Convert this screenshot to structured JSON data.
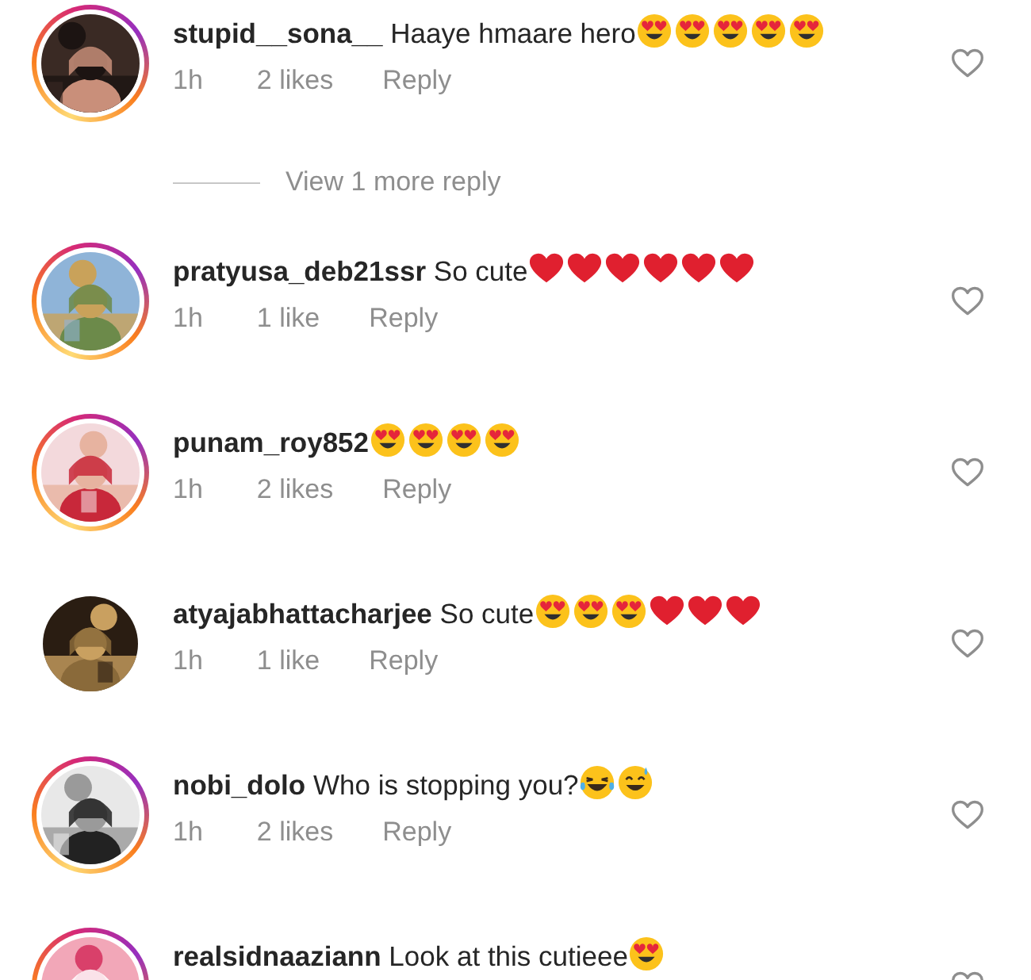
{
  "comments": [
    {
      "username": "stupid__sona__",
      "text": "Haaye hmaare hero",
      "emojis": [
        {
          "kind": "heart_eyes"
        },
        {
          "kind": "heart_eyes"
        },
        {
          "kind": "heart_eyes"
        },
        {
          "kind": "heart_eyes"
        },
        {
          "kind": "heart_eyes"
        }
      ],
      "story_ring": true,
      "time": "1h",
      "likes": "2 likes",
      "reply": "Reply",
      "liked": false,
      "more_replies": "View 1 more reply"
    },
    {
      "username": "pratyusa_deb21ssr",
      "text": "So cute",
      "emojis": [
        {
          "kind": "red_heart"
        },
        {
          "kind": "red_heart"
        },
        {
          "kind": "red_heart"
        },
        {
          "kind": "red_heart"
        },
        {
          "kind": "red_heart"
        },
        {
          "kind": "red_heart"
        }
      ],
      "story_ring": true,
      "time": "1h",
      "likes": "1 like",
      "reply": "Reply",
      "liked": false
    },
    {
      "username": "punam_roy852",
      "emojis": [
        {
          "kind": "heart_eyes"
        },
        {
          "kind": "heart_eyes"
        },
        {
          "kind": "heart_eyes"
        },
        {
          "kind": "heart_eyes"
        }
      ],
      "story_ring": true,
      "time": "1h",
      "likes": "2 likes",
      "reply": "Reply",
      "liked": false
    },
    {
      "username": "atyajabhattacharjee",
      "text": "So cute",
      "emojis": [
        {
          "kind": "heart_eyes"
        },
        {
          "kind": "heart_eyes"
        },
        {
          "kind": "heart_eyes"
        },
        {
          "kind": "red_heart"
        },
        {
          "kind": "red_heart"
        },
        {
          "kind": "red_heart"
        }
      ],
      "story_ring": false,
      "time": "1h",
      "likes": "1 like",
      "reply": "Reply",
      "liked": false
    },
    {
      "username": "nobi_dolo",
      "text": "Who is stopping you?",
      "emojis": [
        {
          "kind": "joy"
        },
        {
          "kind": "sweat_smile"
        }
      ],
      "story_ring": true,
      "time": "1h",
      "likes": "2 likes",
      "reply": "Reply",
      "liked": false
    },
    {
      "username": "realsidnaaziann",
      "text": "Look at this cutieee",
      "emojis": [
        {
          "kind": "heart_eyes"
        }
      ],
      "story_ring": true,
      "liked": false
    }
  ]
}
